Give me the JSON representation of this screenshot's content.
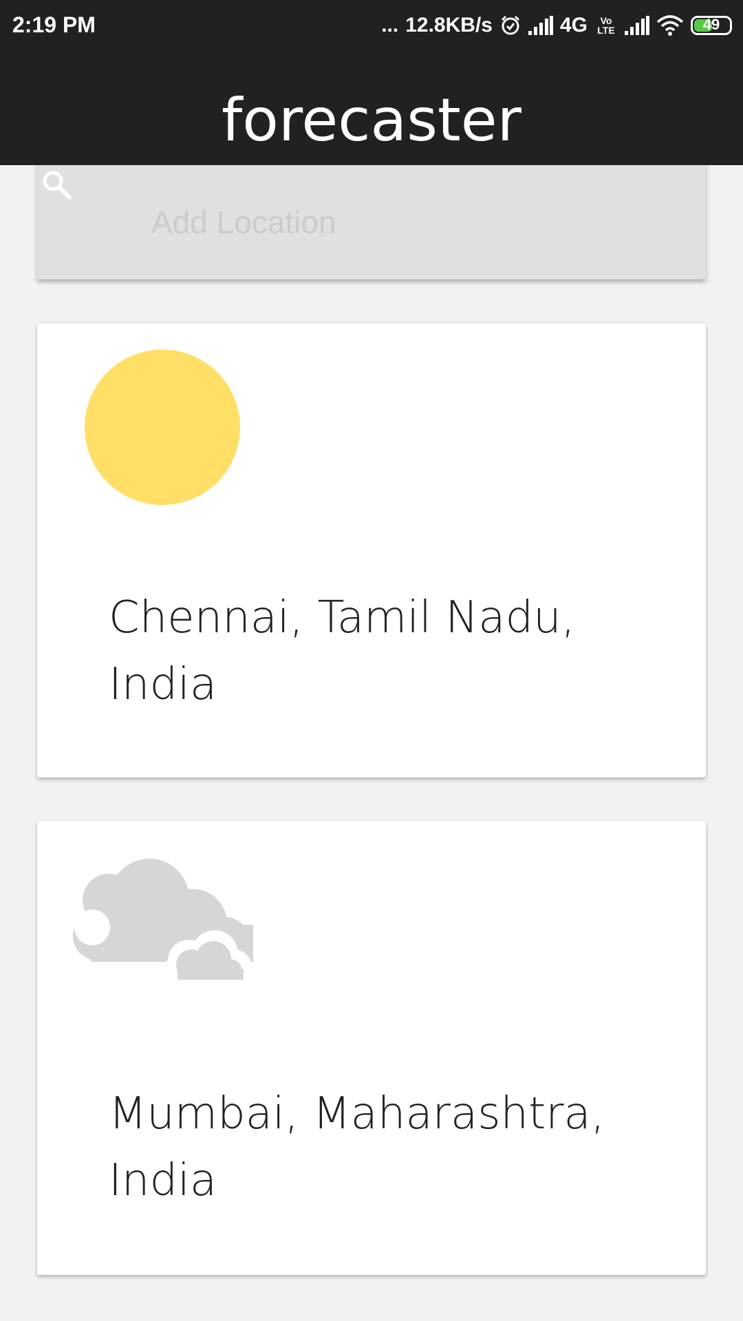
{
  "status_bar": {
    "time": "2:19 PM",
    "more": "...",
    "speed": "12.8KB/s",
    "network": "4G",
    "volte": "Vo LTE",
    "battery": "49",
    "battery_level": 0.49
  },
  "app": {
    "title": "forecaster"
  },
  "search": {
    "placeholder": "Add Location",
    "value": ""
  },
  "locations": [
    {
      "name": "Chennai, Tamil Nadu, India",
      "weather_icon": "sun-icon",
      "icon_color": "#FFDF66"
    },
    {
      "name": "Mumbai, Maharashtra, India",
      "weather_icon": "cloud-icon",
      "icon_color": "#D6D6D6"
    }
  ],
  "colors": {
    "app_bar": "#212121",
    "search_background": "#E0E0E0",
    "background": "#F2F2F2",
    "card": "#FFFFFF"
  }
}
